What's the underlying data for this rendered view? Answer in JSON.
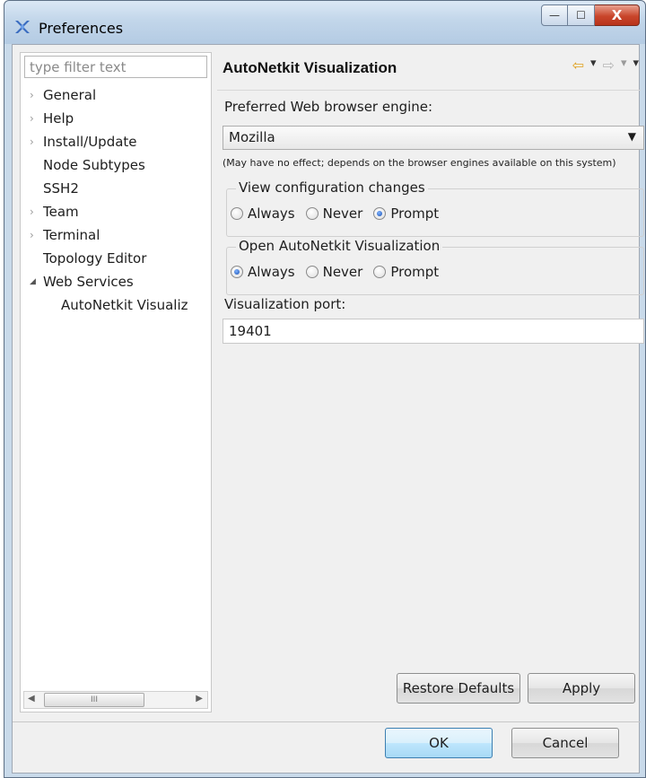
{
  "window": {
    "title": "Preferences",
    "min_symbol": "—",
    "max_symbol": "☐",
    "close_symbol": "X"
  },
  "filter": {
    "placeholder": "type filter text",
    "value": ""
  },
  "tree": {
    "items": [
      {
        "label": "General",
        "arrow": "›",
        "child": false
      },
      {
        "label": "Help",
        "arrow": "›",
        "child": false
      },
      {
        "label": "Install/Update",
        "arrow": "›",
        "child": false
      },
      {
        "label": "Node Subtypes",
        "arrow": "",
        "child": false
      },
      {
        "label": "SSH2",
        "arrow": "",
        "child": false
      },
      {
        "label": "Team",
        "arrow": "›",
        "child": false
      },
      {
        "label": "Terminal",
        "arrow": "›",
        "child": false
      },
      {
        "label": "Topology Editor",
        "arrow": "",
        "child": false
      },
      {
        "label": "Web Services",
        "arrow": "◢",
        "child": false
      },
      {
        "label": "AutoNetkit Visualiz",
        "arrow": "",
        "child": true,
        "selected": true
      }
    ],
    "scroll_left": "◀",
    "scroll_right": "▶",
    "scroll_grip": "III"
  },
  "page": {
    "title": "AutoNetkit Visualization",
    "browser_engine_label": "Preferred Web browser engine:",
    "browser_engine_value": "Mozilla",
    "browser_engine_note": "(May have no effect; depends on the browser engines available on this system)",
    "view_group": {
      "title": "View configuration changes",
      "options": [
        "Always",
        "Never",
        "Prompt"
      ],
      "selected": "Prompt"
    },
    "open_group": {
      "title": "Open AutoNetkit Visualization",
      "options": [
        "Always",
        "Never",
        "Prompt"
      ],
      "selected": "Always"
    },
    "port_label": "Visualization port:",
    "port_value": "19401"
  },
  "buttons": {
    "restore_defaults": "Restore Defaults",
    "apply": "Apply",
    "ok": "OK",
    "cancel": "Cancel"
  },
  "colors": {
    "titlebar": "#c2d6ea",
    "close_button": "#c9452b",
    "radio_selected": "#1a4fb0",
    "nav_back_arrow": "#e0a020"
  }
}
